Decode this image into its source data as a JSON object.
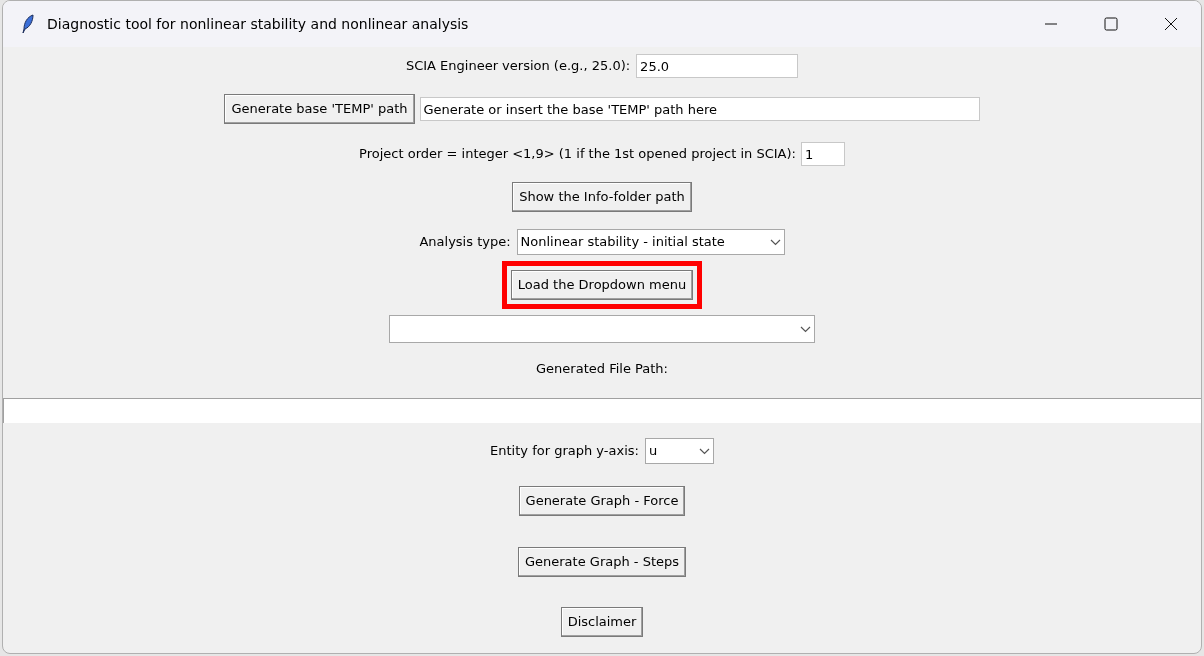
{
  "window": {
    "title": "Diagnostic tool for nonlinear stability and nonlinear analysis"
  },
  "version": {
    "label": "SCIA Engineer version (e.g., 25.0):",
    "value": "25.0"
  },
  "temp_path": {
    "button": "Generate base 'TEMP' path",
    "value": "Generate or insert the base 'TEMP' path here"
  },
  "project_order": {
    "label": "Project order = integer <1,9> (1 if the 1st opened project in SCIA):",
    "value": "1"
  },
  "show_info_button": "Show the Info-folder path",
  "analysis_type": {
    "label": "Analysis type:",
    "value": "Nonlinear stability - initial state"
  },
  "load_button": {
    "label": "Load the Dropdown menu",
    "highlighted": true
  },
  "generated_file_path": {
    "label": "Generated File Path:"
  },
  "entity": {
    "label": "Entity for graph y-axis:",
    "value": "u"
  },
  "buttons": [
    "Generate Graph - Force",
    "Generate Graph - Steps",
    "Disclaimer"
  ]
}
